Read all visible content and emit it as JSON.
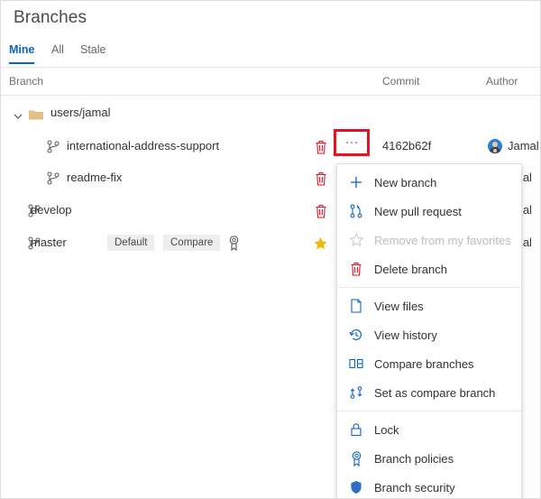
{
  "header": {
    "title": "Branches"
  },
  "tabs": [
    {
      "label": "Mine",
      "selected": true
    },
    {
      "label": "All",
      "selected": false
    },
    {
      "label": "Stale",
      "selected": false
    }
  ],
  "columns": {
    "branch": "Branch",
    "commit": "Commit",
    "author": "Author"
  },
  "group": {
    "label": "users/jamal",
    "expanded": true,
    "chevron_icon": "chevron-down-icon",
    "folder_icon": "folder-icon"
  },
  "rows": [
    {
      "name": "international-address-support",
      "indent": 1,
      "commit": "4162b62f",
      "author": "Jamal",
      "author_truncated": "",
      "delete_icon": "trash-icon",
      "favorite": false,
      "more_button": "...",
      "tags": []
    },
    {
      "name": "readme-fix",
      "indent": 1,
      "commit": "",
      "author": "",
      "author_truncated": "mal",
      "delete_icon": "trash-icon",
      "favorite": false,
      "tags": []
    },
    {
      "name": "develop",
      "indent": 0,
      "commit": "",
      "author": "",
      "author_truncated": "mal",
      "delete_icon": "trash-icon",
      "favorite": false,
      "tags": []
    },
    {
      "name": "master",
      "indent": 0,
      "commit": "",
      "author": "",
      "author_truncated": "mal",
      "delete_icon": "",
      "favorite": true,
      "tags": [
        "Default",
        "Compare"
      ],
      "policy_icon": "branch-policy-icon"
    }
  ],
  "context_menu": {
    "groups": [
      [
        {
          "label": "New branch",
          "icon": "plus-icon",
          "disabled": false
        },
        {
          "label": "New pull request",
          "icon": "pull-request-icon",
          "disabled": false
        },
        {
          "label": "Remove from my favorites",
          "icon": "star-outline-icon",
          "disabled": true
        },
        {
          "label": "Delete branch",
          "icon": "trash-icon",
          "disabled": false
        }
      ],
      [
        {
          "label": "View files",
          "icon": "file-icon",
          "disabled": false
        },
        {
          "label": "View history",
          "icon": "history-icon",
          "disabled": false
        },
        {
          "label": "Compare branches",
          "icon": "compare-icon",
          "disabled": false
        },
        {
          "label": "Set as compare branch",
          "icon": "set-compare-icon",
          "disabled": false
        }
      ],
      [
        {
          "label": "Lock",
          "icon": "lock-icon",
          "disabled": false
        },
        {
          "label": "Branch policies",
          "icon": "branch-policy-icon",
          "disabled": false
        },
        {
          "label": "Branch security",
          "icon": "shield-icon",
          "disabled": false
        }
      ]
    ]
  },
  "colors": {
    "accent": "#0b64c6",
    "danger": "#e81123",
    "star": "#f2b705",
    "folder": "#e2c184",
    "text": "#333333",
    "muted": "#6e6e6e"
  }
}
